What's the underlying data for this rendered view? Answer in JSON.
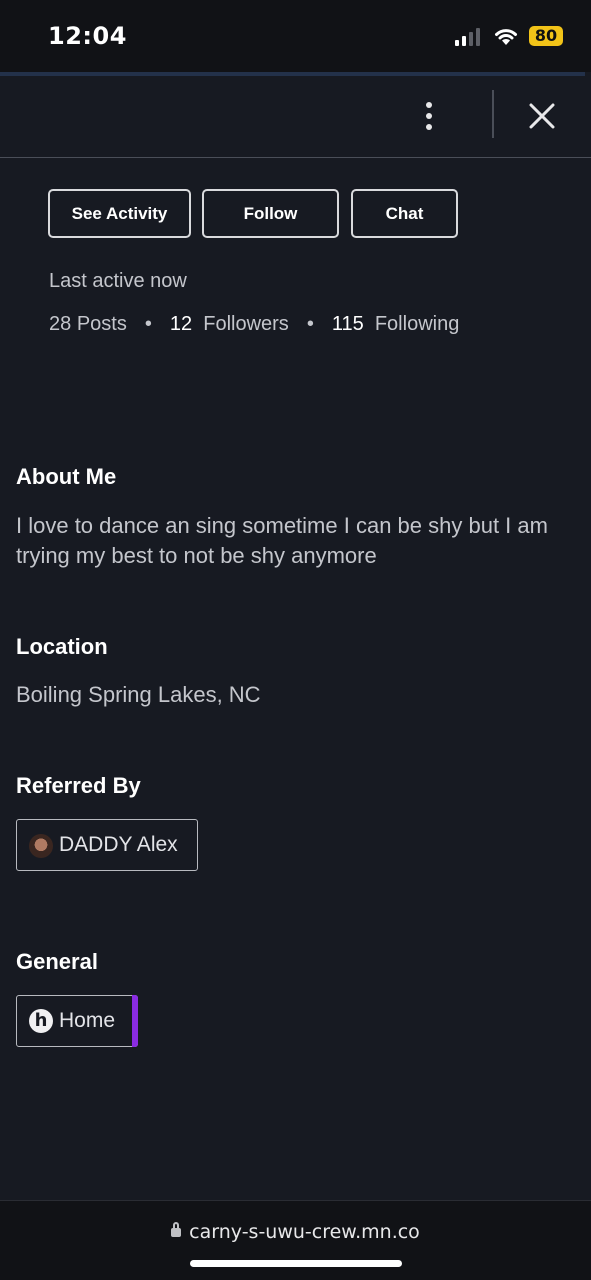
{
  "status_bar": {
    "time": "12:04",
    "battery": "80"
  },
  "header": {
    "more_icon": "more-vertical-icon",
    "close_icon": "close-icon"
  },
  "actions": {
    "see_activity": "See Activity",
    "follow": "Follow",
    "chat": "Chat"
  },
  "profile": {
    "last_active": "Last active now",
    "posts_count": "28",
    "posts_label": "Posts",
    "followers_count": "12",
    "followers_label": "Followers",
    "following_count": "115",
    "following_label": "Following",
    "separator": "•"
  },
  "about": {
    "title": "About Me",
    "text": "I love to dance an sing sometime I can be shy but I am trying my best to not be shy anymore"
  },
  "location": {
    "title": "Location",
    "text": "Boiling Spring Lakes, NC"
  },
  "referred_by": {
    "title": "Referred By",
    "name": "DADDY Alex"
  },
  "general": {
    "title": "General",
    "space_label": "Home",
    "space_icon_letter": "h",
    "accent_color": "#8a2be2"
  },
  "browser": {
    "url": "carny-s-uwu-crew.mn.co"
  },
  "colors": {
    "background": "#171a22",
    "text_muted": "#c4c6cc",
    "battery": "#f2c318"
  }
}
